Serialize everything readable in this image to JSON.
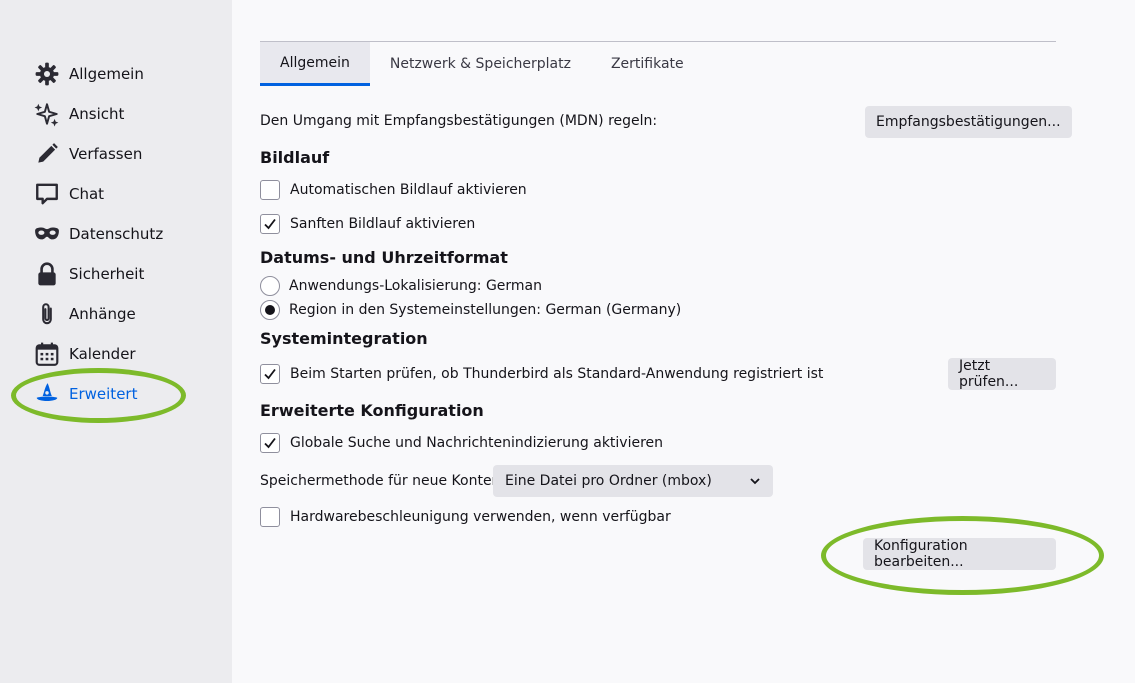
{
  "sidebar": {
    "items": [
      {
        "label": "Allgemein",
        "icon": "gear-icon"
      },
      {
        "label": "Ansicht",
        "icon": "sparkle-icon"
      },
      {
        "label": "Verfassen",
        "icon": "pencil-icon"
      },
      {
        "label": "Chat",
        "icon": "chat-bubble-icon"
      },
      {
        "label": "Datenschutz",
        "icon": "mask-icon"
      },
      {
        "label": "Sicherheit",
        "icon": "lock-icon"
      },
      {
        "label": "Anhänge",
        "icon": "paperclip-icon"
      },
      {
        "label": "Kalender",
        "icon": "calendar-icon"
      },
      {
        "label": "Erweitert",
        "icon": "wizard-hat-icon",
        "selected": true
      }
    ]
  },
  "tabs": [
    {
      "label": "Allgemein",
      "active": true
    },
    {
      "label": "Netzwerk & Speicherplatz",
      "active": false
    },
    {
      "label": "Zertifikate",
      "active": false
    }
  ],
  "mdn": {
    "text": "Den Umgang mit Empfangsbestätigungen (MDN) regeln:",
    "button": "Empfangsbestätigungen..."
  },
  "scrolling": {
    "heading": "Bildlauf",
    "auto_label": "Automatischen Bildlauf aktivieren",
    "auto_checked": false,
    "smooth_label": "Sanften Bildlauf aktivieren",
    "smooth_checked": true
  },
  "datetime": {
    "heading": "Datums- und Uhrzeitformat",
    "app_locale_label": "Anwendungs-Lokalisierung: German",
    "region_label": "Region in den Systemeinstellungen: German (Germany)",
    "selected": "region"
  },
  "system": {
    "heading": "Systemintegration",
    "check_label": "Beim Starten prüfen, ob Thunderbird als Standard-Anwendung registriert ist",
    "checked": true,
    "button": "Jetzt prüfen..."
  },
  "advanced": {
    "heading": "Erweiterte Konfiguration",
    "search_label": "Globale Suche und Nachrichtenindizierung aktivieren",
    "search_checked": true,
    "storage_label": "Speichermethode für neue Konten:",
    "storage_value": "Eine Datei pro Ordner (mbox)",
    "hw_label": "Hardwarebeschleunigung verwenden, wenn verfügbar",
    "hw_checked": false,
    "config_button": "Konfiguration bearbeiten..."
  },
  "colors": {
    "accent": "#0061e0",
    "annotation": "#7dba2a",
    "sidebar_bg": "#ececef",
    "main_bg": "#f9f9fb"
  }
}
